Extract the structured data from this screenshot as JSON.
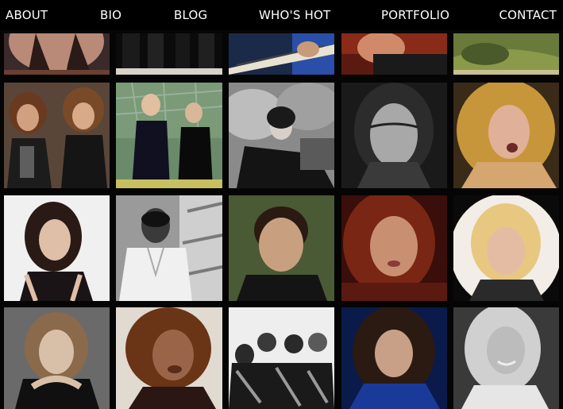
{
  "nav": {
    "items": [
      {
        "label": "ABOUT"
      },
      {
        "label": "BIO"
      },
      {
        "label": "BLOG"
      },
      {
        "label": "WHO'S HOT"
      },
      {
        "label": "PORTFOLIO"
      },
      {
        "label": "CONTACT"
      }
    ]
  },
  "colors": {
    "background": "#000000",
    "nav_text": "#ffffff"
  },
  "gallery": {
    "rows": 4,
    "columns": 5
  }
}
